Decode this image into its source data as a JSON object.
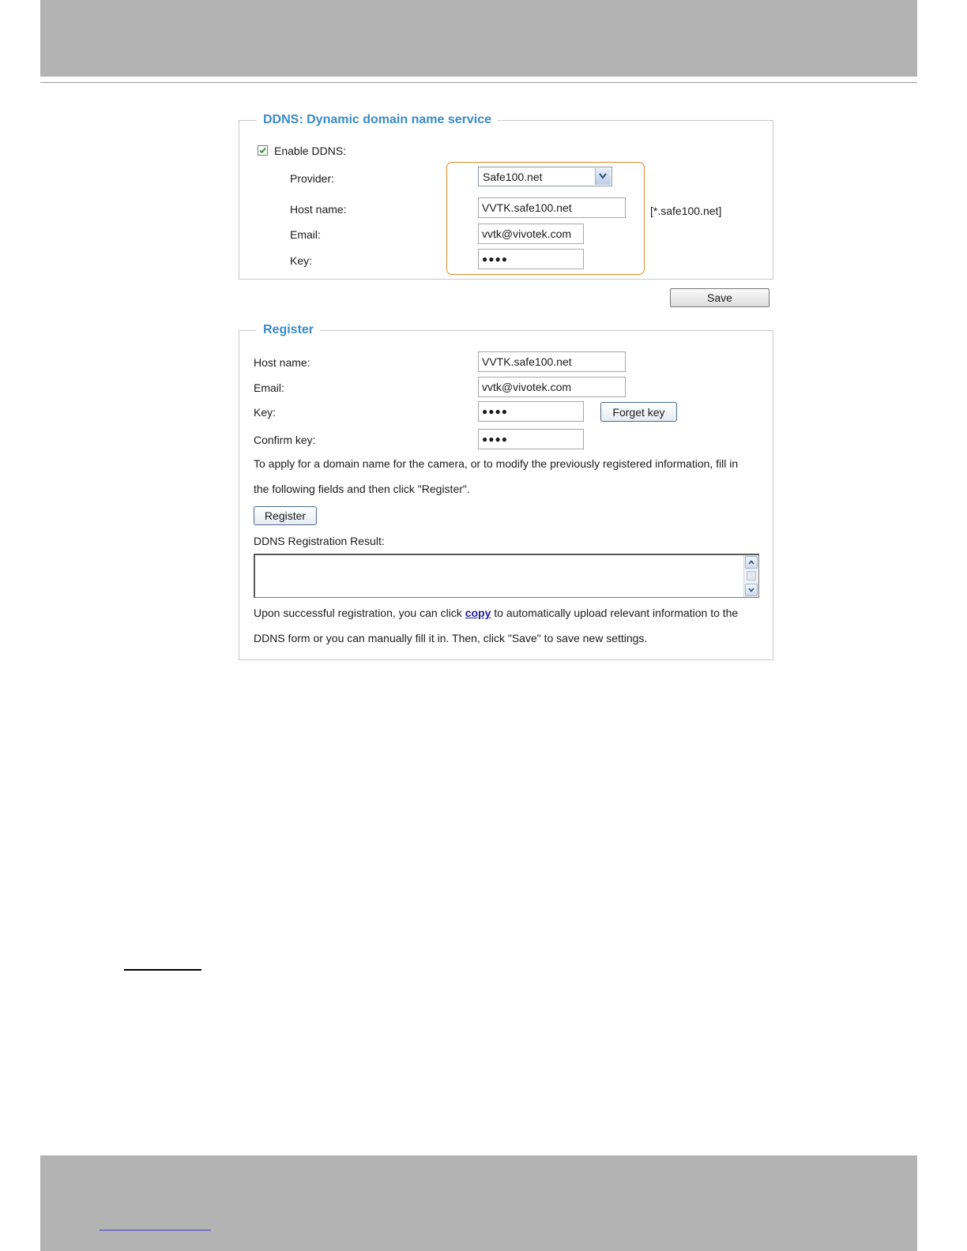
{
  "ddns": {
    "legend": "DDNS: Dynamic domain name service",
    "enable_label": "Enable DDNS:",
    "enable_checked": true,
    "provider_label": "Provider:",
    "provider_value": "Safe100.net",
    "host_label": "Host name:",
    "host_value": "VVTK.safe100.net",
    "host_suffix": "[*.safe100.net]",
    "email_label": "Email:",
    "email_value": "vvtk@vivotek.com",
    "key_label": "Key:",
    "key_value": "●●●●",
    "highlight_color": "#e08a2a",
    "save_label": "Save"
  },
  "register": {
    "legend": "Register",
    "host_label": "Host name:",
    "host_value": "VVTK.safe100.net",
    "email_label": "Email:",
    "email_value": "vvtk@vivotek.com",
    "key_label": "Key:",
    "key_value": "●●●●",
    "forget_key_label": "Forget key",
    "confirm_label": "Confirm key:",
    "confirm_value": "●●●●",
    "instruction_line1": "To apply for a domain name for the camera, or to modify the previously registered information, fill in",
    "instruction_line2": "the following fields and then click \"Register\".",
    "register_label": "Register",
    "result_label": "DDNS Registration Result:",
    "upload_prefix": "Upon successful registration, you can click",
    "copy_link": "copy",
    "upload_suffix": "to automatically upload relevant information to the",
    "upload_line2": "DDNS form or you can manually fill it in. Then, click \"Save\" to save new settings."
  },
  "colors": {
    "legend": "#3a8bc8",
    "link": "#1c1c9c",
    "header_band": "#b3b3b3"
  }
}
